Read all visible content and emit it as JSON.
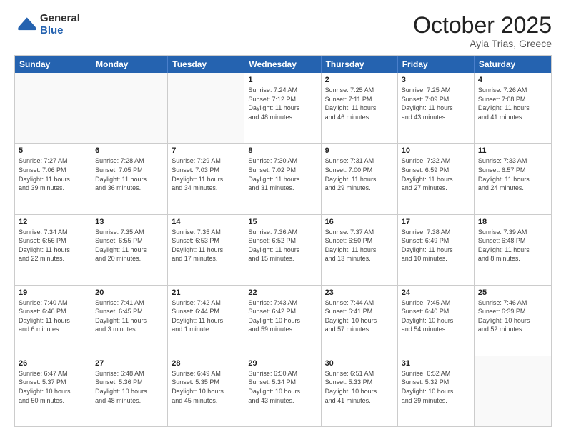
{
  "logo": {
    "general": "General",
    "blue": "Blue"
  },
  "title": "October 2025",
  "location": "Ayia Trias, Greece",
  "days_of_week": [
    "Sunday",
    "Monday",
    "Tuesday",
    "Wednesday",
    "Thursday",
    "Friday",
    "Saturday"
  ],
  "weeks": [
    [
      {
        "day": "",
        "info": ""
      },
      {
        "day": "",
        "info": ""
      },
      {
        "day": "",
        "info": ""
      },
      {
        "day": "1",
        "info": "Sunrise: 7:24 AM\nSunset: 7:12 PM\nDaylight: 11 hours\nand 48 minutes."
      },
      {
        "day": "2",
        "info": "Sunrise: 7:25 AM\nSunset: 7:11 PM\nDaylight: 11 hours\nand 46 minutes."
      },
      {
        "day": "3",
        "info": "Sunrise: 7:25 AM\nSunset: 7:09 PM\nDaylight: 11 hours\nand 43 minutes."
      },
      {
        "day": "4",
        "info": "Sunrise: 7:26 AM\nSunset: 7:08 PM\nDaylight: 11 hours\nand 41 minutes."
      }
    ],
    [
      {
        "day": "5",
        "info": "Sunrise: 7:27 AM\nSunset: 7:06 PM\nDaylight: 11 hours\nand 39 minutes."
      },
      {
        "day": "6",
        "info": "Sunrise: 7:28 AM\nSunset: 7:05 PM\nDaylight: 11 hours\nand 36 minutes."
      },
      {
        "day": "7",
        "info": "Sunrise: 7:29 AM\nSunset: 7:03 PM\nDaylight: 11 hours\nand 34 minutes."
      },
      {
        "day": "8",
        "info": "Sunrise: 7:30 AM\nSunset: 7:02 PM\nDaylight: 11 hours\nand 31 minutes."
      },
      {
        "day": "9",
        "info": "Sunrise: 7:31 AM\nSunset: 7:00 PM\nDaylight: 11 hours\nand 29 minutes."
      },
      {
        "day": "10",
        "info": "Sunrise: 7:32 AM\nSunset: 6:59 PM\nDaylight: 11 hours\nand 27 minutes."
      },
      {
        "day": "11",
        "info": "Sunrise: 7:33 AM\nSunset: 6:57 PM\nDaylight: 11 hours\nand 24 minutes."
      }
    ],
    [
      {
        "day": "12",
        "info": "Sunrise: 7:34 AM\nSunset: 6:56 PM\nDaylight: 11 hours\nand 22 minutes."
      },
      {
        "day": "13",
        "info": "Sunrise: 7:35 AM\nSunset: 6:55 PM\nDaylight: 11 hours\nand 20 minutes."
      },
      {
        "day": "14",
        "info": "Sunrise: 7:35 AM\nSunset: 6:53 PM\nDaylight: 11 hours\nand 17 minutes."
      },
      {
        "day": "15",
        "info": "Sunrise: 7:36 AM\nSunset: 6:52 PM\nDaylight: 11 hours\nand 15 minutes."
      },
      {
        "day": "16",
        "info": "Sunrise: 7:37 AM\nSunset: 6:50 PM\nDaylight: 11 hours\nand 13 minutes."
      },
      {
        "day": "17",
        "info": "Sunrise: 7:38 AM\nSunset: 6:49 PM\nDaylight: 11 hours\nand 10 minutes."
      },
      {
        "day": "18",
        "info": "Sunrise: 7:39 AM\nSunset: 6:48 PM\nDaylight: 11 hours\nand 8 minutes."
      }
    ],
    [
      {
        "day": "19",
        "info": "Sunrise: 7:40 AM\nSunset: 6:46 PM\nDaylight: 11 hours\nand 6 minutes."
      },
      {
        "day": "20",
        "info": "Sunrise: 7:41 AM\nSunset: 6:45 PM\nDaylight: 11 hours\nand 3 minutes."
      },
      {
        "day": "21",
        "info": "Sunrise: 7:42 AM\nSunset: 6:44 PM\nDaylight: 11 hours\nand 1 minute."
      },
      {
        "day": "22",
        "info": "Sunrise: 7:43 AM\nSunset: 6:42 PM\nDaylight: 10 hours\nand 59 minutes."
      },
      {
        "day": "23",
        "info": "Sunrise: 7:44 AM\nSunset: 6:41 PM\nDaylight: 10 hours\nand 57 minutes."
      },
      {
        "day": "24",
        "info": "Sunrise: 7:45 AM\nSunset: 6:40 PM\nDaylight: 10 hours\nand 54 minutes."
      },
      {
        "day": "25",
        "info": "Sunrise: 7:46 AM\nSunset: 6:39 PM\nDaylight: 10 hours\nand 52 minutes."
      }
    ],
    [
      {
        "day": "26",
        "info": "Sunrise: 6:47 AM\nSunset: 5:37 PM\nDaylight: 10 hours\nand 50 minutes."
      },
      {
        "day": "27",
        "info": "Sunrise: 6:48 AM\nSunset: 5:36 PM\nDaylight: 10 hours\nand 48 minutes."
      },
      {
        "day": "28",
        "info": "Sunrise: 6:49 AM\nSunset: 5:35 PM\nDaylight: 10 hours\nand 45 minutes."
      },
      {
        "day": "29",
        "info": "Sunrise: 6:50 AM\nSunset: 5:34 PM\nDaylight: 10 hours\nand 43 minutes."
      },
      {
        "day": "30",
        "info": "Sunrise: 6:51 AM\nSunset: 5:33 PM\nDaylight: 10 hours\nand 41 minutes."
      },
      {
        "day": "31",
        "info": "Sunrise: 6:52 AM\nSunset: 5:32 PM\nDaylight: 10 hours\nand 39 minutes."
      },
      {
        "day": "",
        "info": ""
      }
    ]
  ]
}
